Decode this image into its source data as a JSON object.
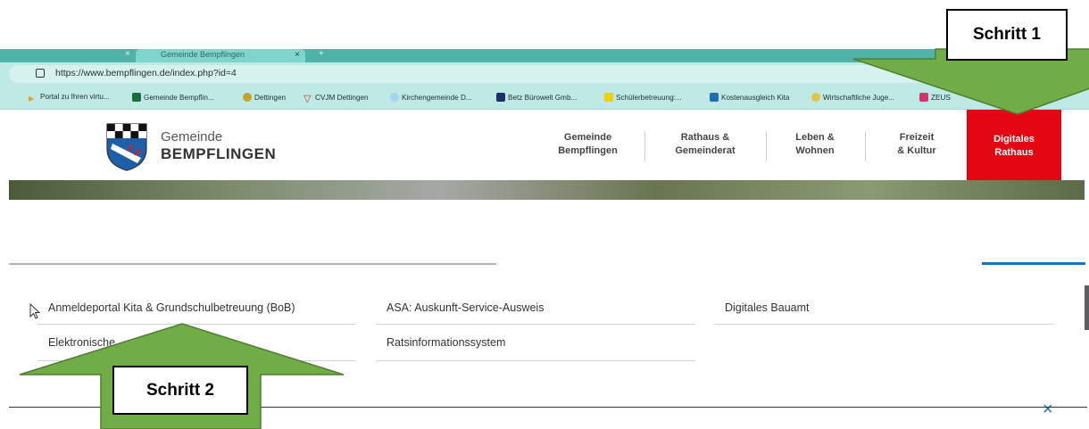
{
  "browser": {
    "active_tab_title": "Gemeinde Bempflingen",
    "url": "https://www.bempflingen.de/index.php?id=4",
    "bookmarks": [
      "Portal zu Ihren virtu...",
      "Gemeinde Bempflin...",
      "Dettingen",
      "CVJM Dettingen",
      "Kirchengemeinde D...",
      "Betz Bürowelt Gmb...",
      "Schülerbetreuung:...",
      "Kostenausgleich Kita",
      "Wirtschaftliche Juge...",
      "ZEUS"
    ]
  },
  "site": {
    "brand_top": "Gemeinde",
    "brand_bottom": "BEMPFLINGEN",
    "nav": [
      {
        "line1": "Gemeinde",
        "line2": "Bempflingen"
      },
      {
        "line1": "Rathaus &",
        "line2": "Gemeinderat"
      },
      {
        "line1": "Leben &",
        "line2": "Wohnen"
      },
      {
        "line1": "Freizeit",
        "line2": "& Kultur"
      },
      {
        "line1": "Digitales",
        "line2": "Rathaus"
      }
    ]
  },
  "menu": {
    "col1": [
      "Anmeldeportal Kita & Grundschulbetreuung (BoB)",
      "Elektronische"
    ],
    "col2": [
      "ASA: Auskunft-Service-Ausweis",
      "Ratsinformationssystem"
    ],
    "col3": [
      "Digitales Bauamt"
    ],
    "close_symbol": "×"
  },
  "annotations": {
    "step1": "Schritt 1",
    "step2": "Schritt 2"
  },
  "colors": {
    "tab_strip": "#4fb3a9",
    "accent_red": "#e30613",
    "annotation_arrow": "#70ad47",
    "link_blue": "#1a73c0"
  }
}
